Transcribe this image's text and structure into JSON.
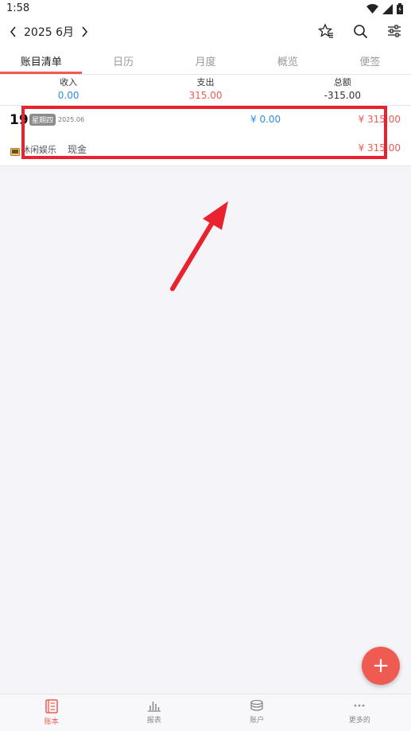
{
  "status_bar": {
    "time": "1:58"
  },
  "nav": {
    "title": "2025 6月"
  },
  "tabs": [
    {
      "label": "账目清单",
      "active": true
    },
    {
      "label": "日历",
      "active": false
    },
    {
      "label": "月度",
      "active": false
    },
    {
      "label": "概览",
      "active": false
    },
    {
      "label": "便签",
      "active": false
    }
  ],
  "summary": {
    "income_label": "收入",
    "income_value": "0.00",
    "expense_label": "支出",
    "expense_value": "315.00",
    "total_label": "总额",
    "total_value": "-315.00"
  },
  "record": {
    "day": "19",
    "weekday": "星期四",
    "date": "2025.06",
    "day_income": "¥ 0.00",
    "day_expense": "¥ 315.00",
    "category": "休闲娱乐",
    "account": "现金",
    "amount": "¥ 315.00"
  },
  "fab": {
    "label": "+"
  },
  "bottom_nav": [
    {
      "label": "账本",
      "icon": "ledger-icon",
      "active": true
    },
    {
      "label": "报表",
      "icon": "chart-icon",
      "active": false
    },
    {
      "label": "账户",
      "icon": "coins-icon",
      "active": false
    },
    {
      "label": "更多的",
      "icon": "more-icon",
      "active": false
    }
  ],
  "colors": {
    "accent": "#ef5b50",
    "income": "#2f8de4",
    "highlight": "#e8222e"
  }
}
